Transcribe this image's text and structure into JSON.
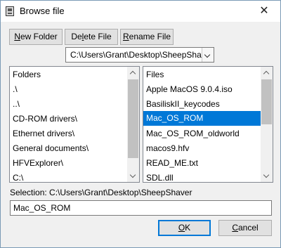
{
  "window": {
    "title": "Browse file",
    "close_glyph": "✕",
    "icon": "file-browser-icon"
  },
  "toolbar": {
    "new_folder": {
      "prefix": "",
      "accel": "N",
      "rest": "ew Folder"
    },
    "delete_file": {
      "prefix": "De",
      "accel": "l",
      "rest": "ete File"
    },
    "rename_file": {
      "prefix": "",
      "accel": "R",
      "rest": "ename File"
    }
  },
  "path_combo": {
    "value": "C:\\Users\\Grant\\Desktop\\SheepShaver"
  },
  "folders": {
    "header": "Folders",
    "items": [
      ".\\",
      "..\\",
      "CD-ROM drivers\\",
      "Ethernet drivers\\",
      "General documents\\",
      "HFVExplorer\\",
      "C:\\"
    ]
  },
  "files": {
    "header": "Files",
    "items": [
      "Apple MacOS 9.0.4.iso",
      "BasiliskII_keycodes",
      "Mac_OS_ROM",
      "Mac_OS_ROM_oldworld",
      "macos9.hfv",
      "READ_ME.txt",
      "SDL.dll"
    ],
    "selected_index": 2
  },
  "selection": {
    "label": "Selection: C:\\Users\\Grant\\Desktop\\SheepShaver",
    "value": "Mac_OS_ROM"
  },
  "buttons": {
    "ok": {
      "accel": "O",
      "rest": "K"
    },
    "cancel": {
      "accel": "C",
      "rest": "ancel"
    }
  },
  "colors": {
    "selection": "#0078d7",
    "default_button_border": "#0078d7"
  }
}
